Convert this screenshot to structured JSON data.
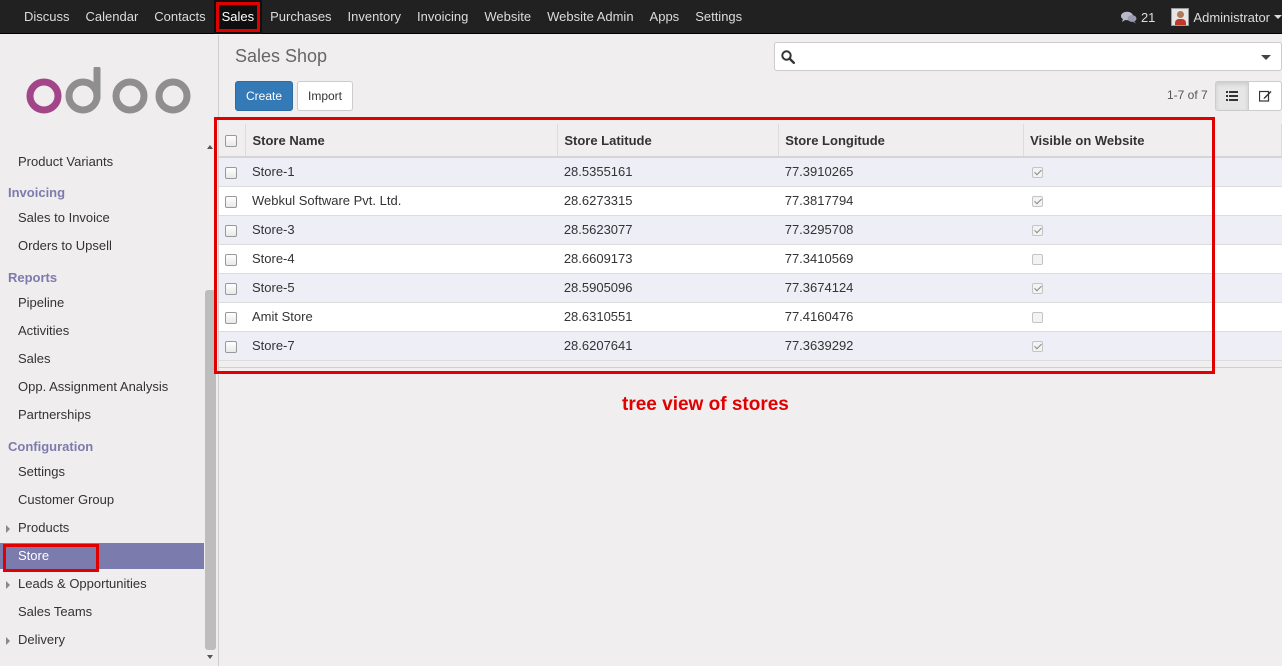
{
  "topbar": {
    "nav": [
      "Discuss",
      "Calendar",
      "Contacts",
      "Sales",
      "Purchases",
      "Inventory",
      "Invoicing",
      "Website",
      "Website Admin",
      "Apps",
      "Settings"
    ],
    "active": "Sales",
    "messages_count": "21",
    "user_name": "Administrator"
  },
  "logo_text": "odoo",
  "sidebar": {
    "items_top": [
      {
        "label": "Product Variants"
      }
    ],
    "section_invoicing": "Invoicing",
    "invoicing_items": [
      {
        "label": "Sales to Invoice"
      },
      {
        "label": "Orders to Upsell"
      }
    ],
    "section_reports": "Reports",
    "reports_items": [
      {
        "label": "Pipeline"
      },
      {
        "label": "Activities"
      },
      {
        "label": "Sales"
      },
      {
        "label": "Opp. Assignment Analysis"
      },
      {
        "label": "Partnerships"
      }
    ],
    "section_configuration": "Configuration",
    "configuration_items": [
      {
        "label": "Settings"
      },
      {
        "label": "Customer Group"
      },
      {
        "label": "Products"
      },
      {
        "label": "Store"
      },
      {
        "label": "Leads & Opportunities"
      },
      {
        "label": "Sales Teams"
      },
      {
        "label": "Delivery"
      }
    ]
  },
  "main": {
    "title": "Sales Shop",
    "search_placeholder": "",
    "create_label": "Create",
    "import_label": "Import",
    "pager": "1-7 of 7",
    "columns": [
      "Store Name",
      "Store Latitude",
      "Store Longitude",
      "Visible on Website"
    ],
    "rows": [
      {
        "name": "Store-1",
        "lat": "28.5355161",
        "lng": "77.3910265",
        "visible": true
      },
      {
        "name": "Webkul Software Pvt. Ltd.",
        "lat": "28.6273315",
        "lng": "77.3817794",
        "visible": true
      },
      {
        "name": "Store-3",
        "lat": "28.5623077",
        "lng": "77.3295708",
        "visible": true
      },
      {
        "name": "Store-4",
        "lat": "28.6609173",
        "lng": "77.3410569",
        "visible": false
      },
      {
        "name": "Store-5",
        "lat": "28.5905096",
        "lng": "77.3674124",
        "visible": true
      },
      {
        "name": "Amit Store",
        "lat": "28.6310551",
        "lng": "77.4160476",
        "visible": false
      },
      {
        "name": "Store-7",
        "lat": "28.6207641",
        "lng": "77.3639292",
        "visible": true
      }
    ]
  },
  "annotation": "tree view of stores",
  "colors": {
    "topbar": "#212121",
    "sidebar_accent": "#7c7bad",
    "primary_button": "#337ab7",
    "highlight": "#e00000",
    "logo_purple": "#a24689",
    "logo_gray": "#8f8f8f"
  },
  "icons": [
    "chat-icon",
    "search-icon",
    "list-view-icon",
    "form-view-icon",
    "caret-down-icon"
  ]
}
